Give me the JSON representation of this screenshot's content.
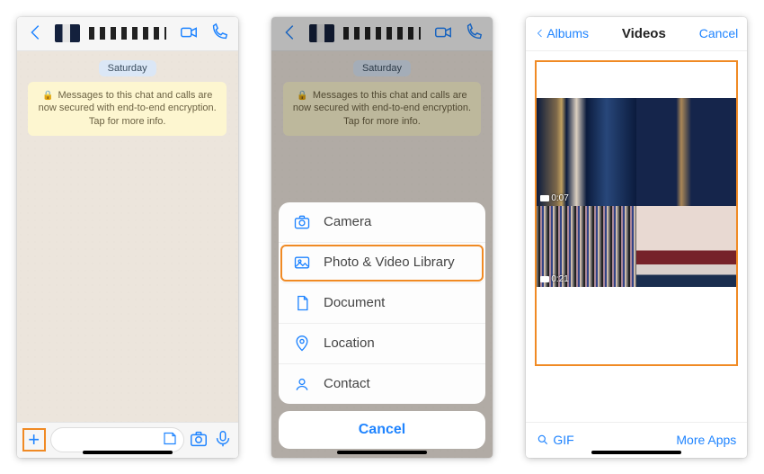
{
  "panel1": {
    "day_label": "Saturday",
    "encryption_text": "Messages to this chat and calls are now secured with end-to-end encryption. Tap for more info."
  },
  "panel2": {
    "day_label": "Saturday",
    "encryption_text": "Messages to this chat and calls are now secured with end-to-end encryption. Tap for more info.",
    "sheet": {
      "camera": "Camera",
      "library": "Photo & Video Library",
      "document": "Document",
      "location": "Location",
      "contact": "Contact",
      "cancel": "Cancel"
    }
  },
  "panel3": {
    "albums": "Albums",
    "title": "Videos",
    "cancel": "Cancel",
    "durations": {
      "v1": "0:07",
      "v2": "0:21"
    },
    "gif": "GIF",
    "more": "More Apps"
  },
  "colors": {
    "accent": "#1f84ff",
    "highlight": "#f08a24"
  }
}
